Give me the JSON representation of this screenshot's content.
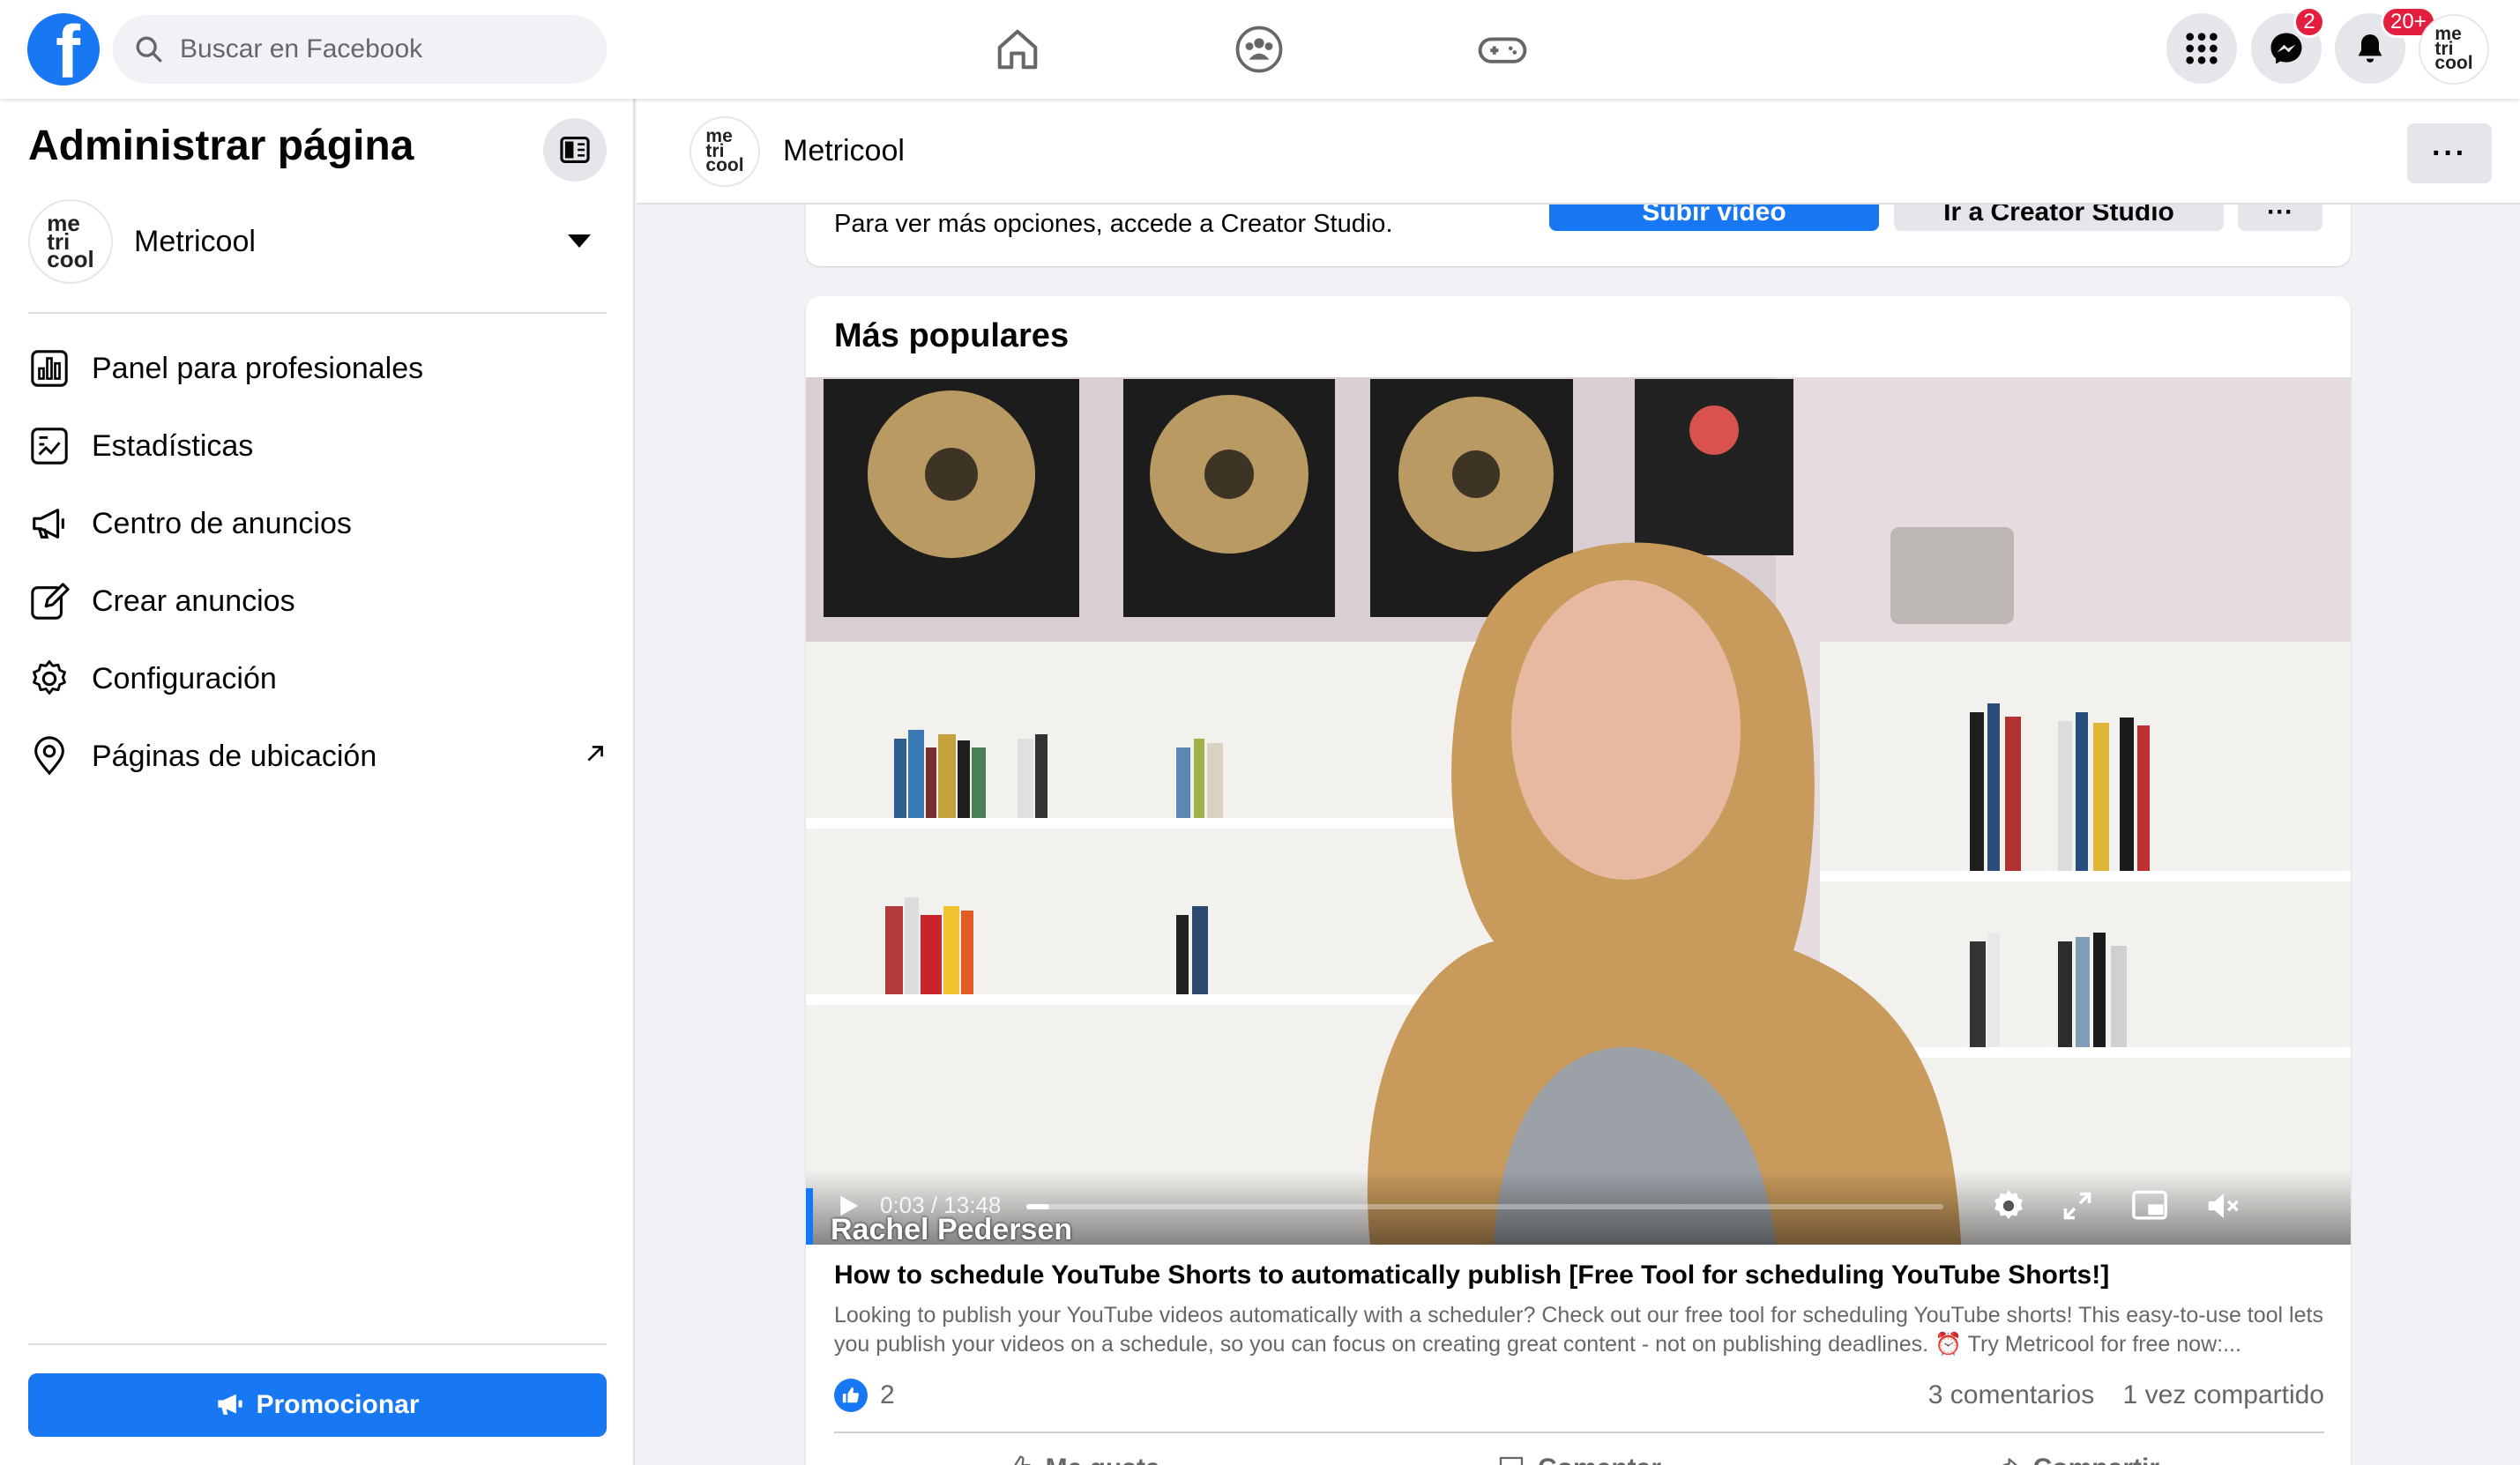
{
  "topbar": {
    "logo_letter": "f",
    "search_placeholder": "Buscar en Facebook",
    "messenger_badge": "2",
    "notifications_badge": "20+",
    "account_avatar": [
      "me",
      "tri",
      "cool"
    ]
  },
  "sidebar": {
    "title": "Administrar página",
    "page_name": "Metricool",
    "page_avatar": [
      "me",
      "tri",
      "cool"
    ],
    "items": [
      {
        "label": "Panel para profesionales",
        "icon": "dashboard-icon"
      },
      {
        "label": "Estadísticas",
        "icon": "insights-icon"
      },
      {
        "label": "Centro de anuncios",
        "icon": "megaphone-icon"
      },
      {
        "label": "Crear anuncios",
        "icon": "edit-icon"
      },
      {
        "label": "Configuración",
        "icon": "gear-icon"
      },
      {
        "label": "Páginas de ubicación",
        "icon": "location-pin-icon"
      }
    ],
    "promote_label": "Promocionar"
  },
  "page_header": {
    "name": "Metricool",
    "avatar": [
      "me",
      "tri",
      "cool"
    ],
    "more_label": "···"
  },
  "creator_card": {
    "text": "Para ver más opciones, accede a Creator Studio.",
    "upload_button": "Subir vídeo",
    "creator_studio_button": "Ir a Creator Studio",
    "more_button": "···"
  },
  "popular": {
    "title": "Más populares",
    "video": {
      "time": "0:03 / 13:48",
      "progress_fraction": 0.004,
      "caption": "Rachel Pedersen"
    },
    "video_title": "How to schedule YouTube Shorts to automatically publish [Free Tool for scheduling YouTube Shorts!]",
    "description": "Looking to publish your YouTube videos automatically with a scheduler? Check out our free tool for scheduling YouTube shorts! This easy-to-use tool lets you publish your videos on a schedule, so you can focus on creating great content - not on publishing deadlines. ⏰ Try Metricool for free now:...",
    "likes": "2",
    "comments": "3 comentarios",
    "shares": "1 vez compartido",
    "actions": [
      "Me gusta",
      "Comentar",
      "Compartir"
    ]
  },
  "colors": {
    "brand_blue": "#1877f2",
    "badge_red": "#e41e3f",
    "text_secondary": "#65676b"
  }
}
